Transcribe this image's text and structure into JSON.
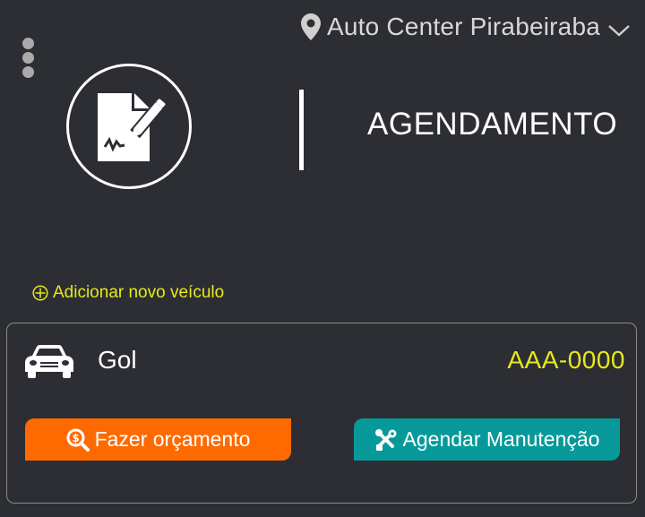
{
  "header": {
    "location_name": "Auto Center Pirabeiraba",
    "title": "AGENDAMENTO"
  },
  "icons": {
    "menu": "kebab-menu-icon",
    "location": "map-pin-icon",
    "dropdown": "chevron-down-icon",
    "logo": "document-signature-icon",
    "add": "circle-plus-icon",
    "vehicle": "car-icon",
    "quote": "magnify-dollar-icon",
    "schedule": "tools-icon"
  },
  "actions": {
    "add_vehicle_label": "Adicionar novo veículo"
  },
  "vehicle": {
    "model": "Gol",
    "plate": "AAA-0000",
    "quote_button": "Fazer orçamento",
    "schedule_button": "Agendar Manutenção"
  },
  "colors": {
    "background": "#2c2e33",
    "accent_yellow": "#e8e81e",
    "quote_orange": "#ff6a00",
    "schedule_teal": "#07999a"
  }
}
